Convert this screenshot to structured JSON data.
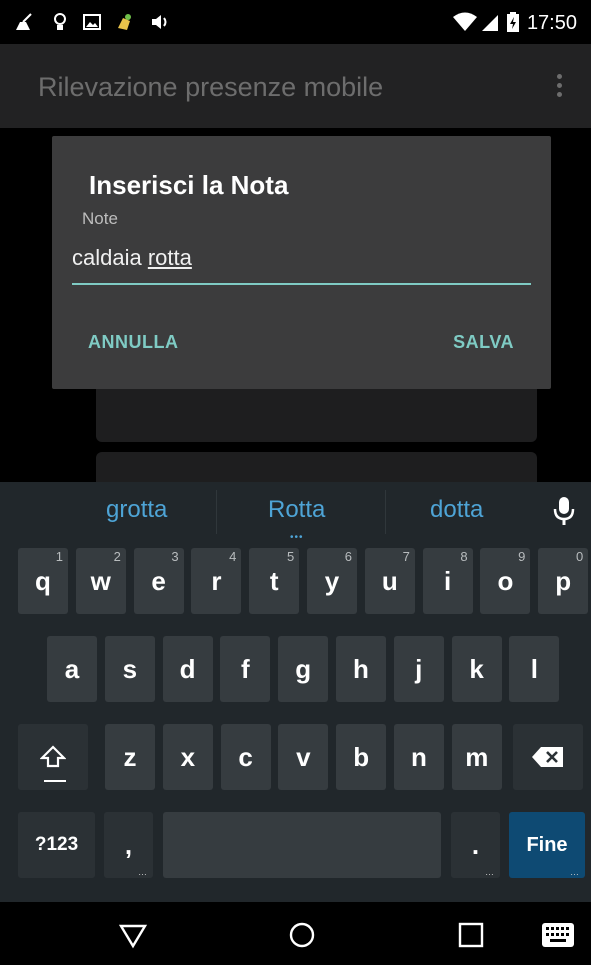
{
  "status": {
    "time": "17:50",
    "left_icons": [
      "broom-icon",
      "lightbulb-icon",
      "image-icon",
      "cleaner-app-icon",
      "volume-icon"
    ],
    "right_icons": [
      "wifi-icon",
      "signal-icon",
      "battery-charging-icon"
    ]
  },
  "appbar": {
    "title": "Rilevazione presenze mobile",
    "menu_icon": "overflow-menu-icon"
  },
  "dialog": {
    "title": "Inserisci la Nota",
    "label": "Note",
    "value_prefix": "caldaia ",
    "value_underlined": "rotta",
    "cancel_label": "ANNULLA",
    "save_label": "SALVA"
  },
  "keyboard": {
    "suggestions": [
      "grotta",
      "Rotta",
      "dotta"
    ],
    "row1": [
      {
        "label": "q",
        "hint": "1"
      },
      {
        "label": "w",
        "hint": "2"
      },
      {
        "label": "e",
        "hint": "3"
      },
      {
        "label": "r",
        "hint": "4"
      },
      {
        "label": "t",
        "hint": "5"
      },
      {
        "label": "y",
        "hint": "6"
      },
      {
        "label": "u",
        "hint": "7"
      },
      {
        "label": "i",
        "hint": "8"
      },
      {
        "label": "o",
        "hint": "9"
      },
      {
        "label": "p",
        "hint": "0"
      }
    ],
    "row2": [
      "a",
      "s",
      "d",
      "f",
      "g",
      "h",
      "j",
      "k",
      "l"
    ],
    "row3": [
      "z",
      "x",
      "c",
      "v",
      "b",
      "n",
      "m"
    ],
    "symbols_label": "?123",
    "comma_label": ",",
    "period_label": ".",
    "enter_label": "Fine"
  },
  "colors": {
    "accent": "#7fcbc4",
    "suggestion": "#4ea4d6",
    "enter_key": "#0e4a73"
  }
}
